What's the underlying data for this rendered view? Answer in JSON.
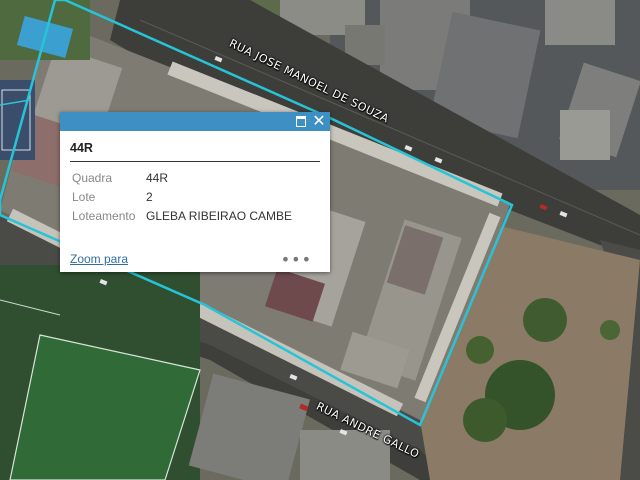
{
  "map": {
    "street_labels": [
      {
        "id": "rua-jose-manoel-de-souza",
        "text": "RUA JOSE MANOEL DE SOUZA"
      },
      {
        "id": "rua-andre-gallo",
        "text": "RUA ANDRE GALLO"
      }
    ],
    "colors": {
      "parcel_outline": "#27c4d8",
      "popup_header": "#3d8fc4",
      "link": "#2f6ea3"
    }
  },
  "popup": {
    "title": "44R",
    "fields": [
      {
        "key": "Quadra",
        "value": "44R"
      },
      {
        "key": "Lote",
        "value": "2"
      },
      {
        "key": "Loteamento",
        "value": "GLEBA RIBEIRAO CAMBE"
      }
    ],
    "zoom_link": "Zoom para",
    "more_icon": "ellipsis-icon",
    "maximize_icon": "maximize-icon",
    "close_icon": "close-icon"
  }
}
